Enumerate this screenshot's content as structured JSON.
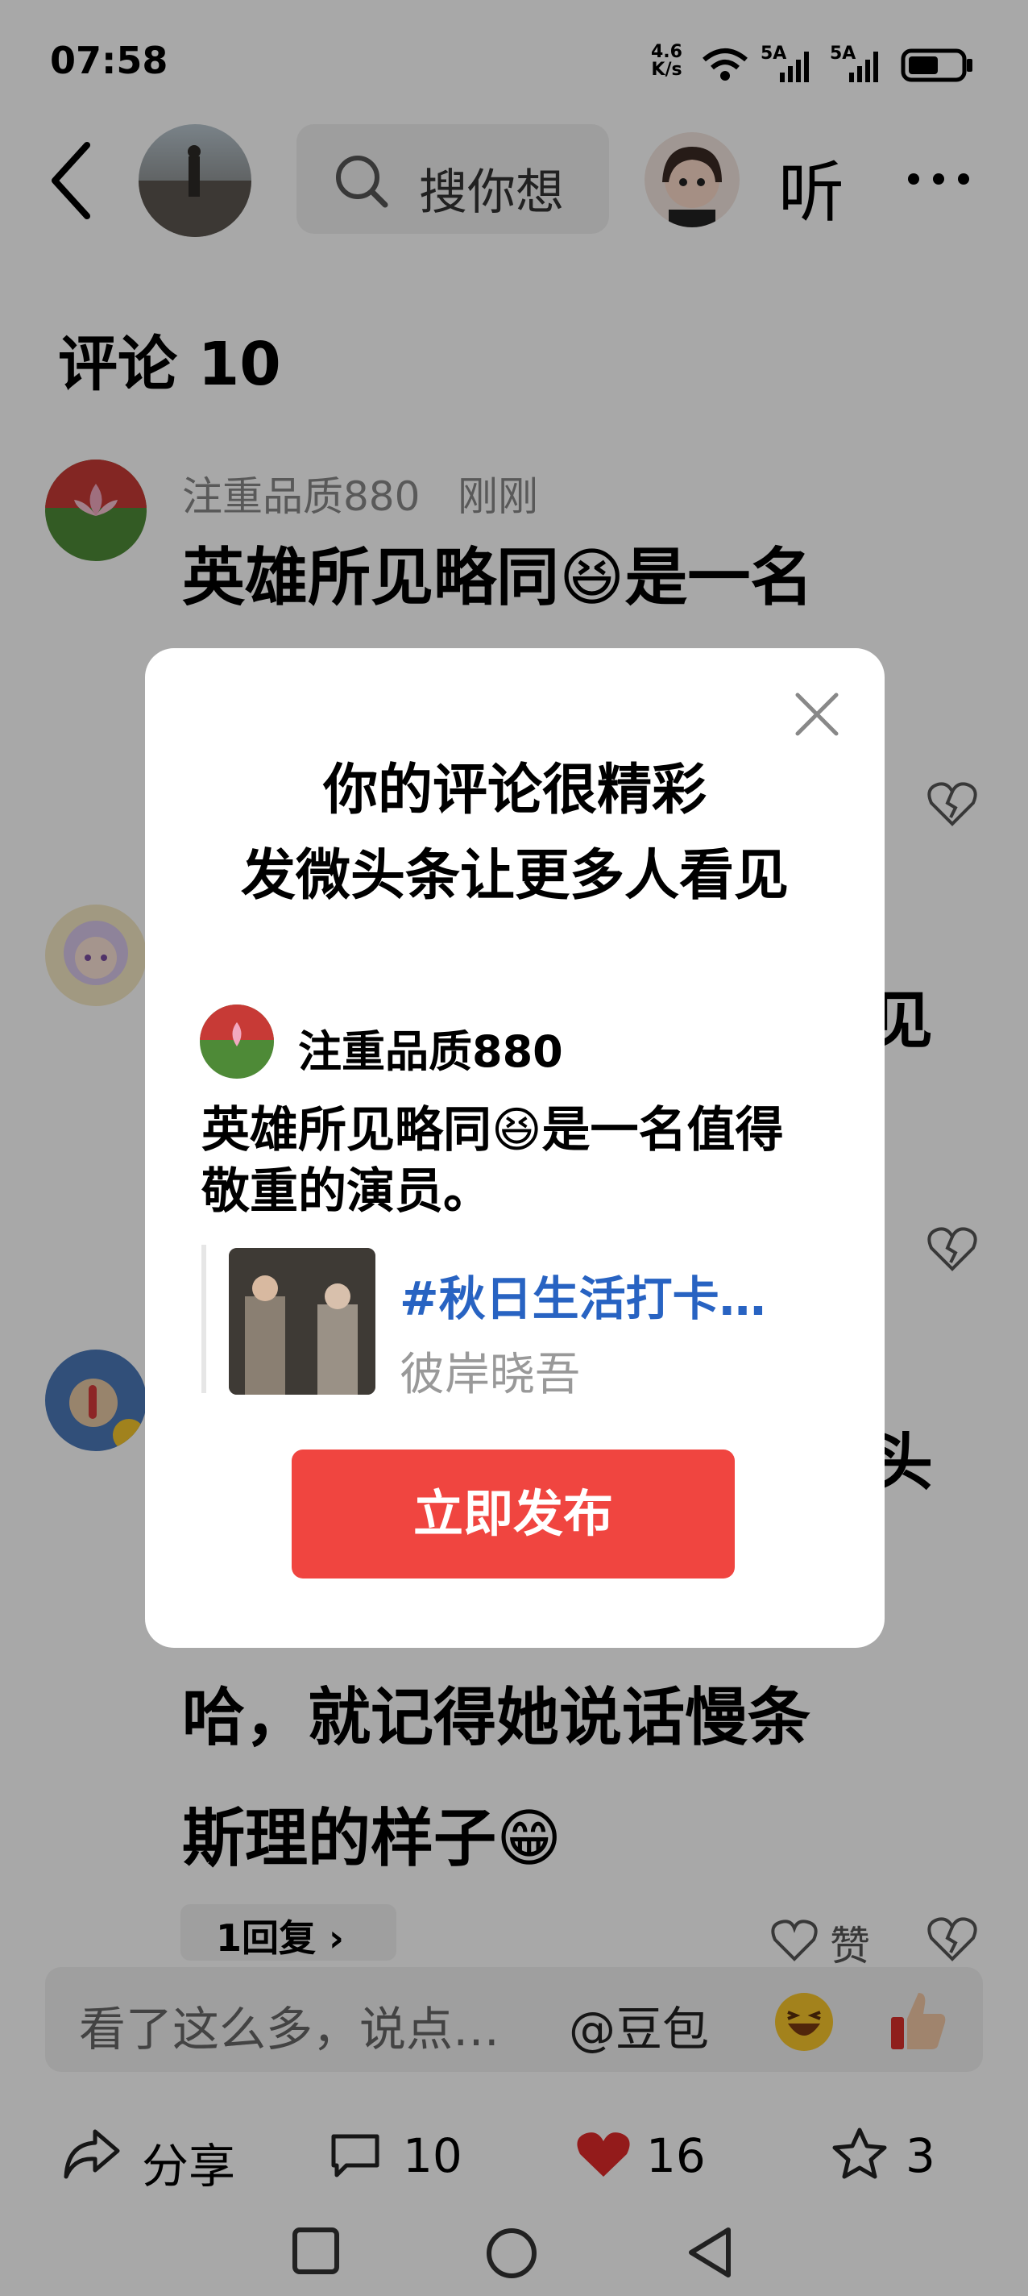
{
  "status_bar": {
    "time": "07:58",
    "net_speed_top": "4.6",
    "net_speed_bottom": "K/s",
    "sim1": "5A",
    "sim2": "5A"
  },
  "header": {
    "search_placeholder": "搜你想",
    "listen_label": "听",
    "more_label": "···"
  },
  "comments": {
    "title": "评论 10",
    "items": [
      {
        "user": "注重品质880",
        "time": "刚刚",
        "text_visible": "英雄所见略同😆是一名"
      },
      {
        "text_fragment_right": "见"
      },
      {
        "text_fragment_right": "头",
        "line2": "哈，就记得她说话慢条",
        "line3": "斯理的样子😁",
        "reply_label": "1回复 ›",
        "like_label": "赞"
      }
    ]
  },
  "input_bar": {
    "placeholder": "看了这么多，说点…",
    "at_label": "@豆包"
  },
  "bottom_bar": {
    "share_label": "分享",
    "comment_count": "10",
    "like_count": "16",
    "fav_count": "3"
  },
  "modal": {
    "title_line1": "你的评论很精彩",
    "title_line2": "发微头条让更多人看见",
    "user": "注重品质880",
    "text_line1": "英雄所见略同😆是一名值得",
    "text_line2": "敬重的演员。",
    "topic": "#秋日生活打卡…",
    "author": "彼岸晓吾",
    "publish_label": "立即发布"
  },
  "colors": {
    "accent_red": "#f04540",
    "topic_blue": "#2863c2",
    "like_red": "#e02a2a"
  }
}
